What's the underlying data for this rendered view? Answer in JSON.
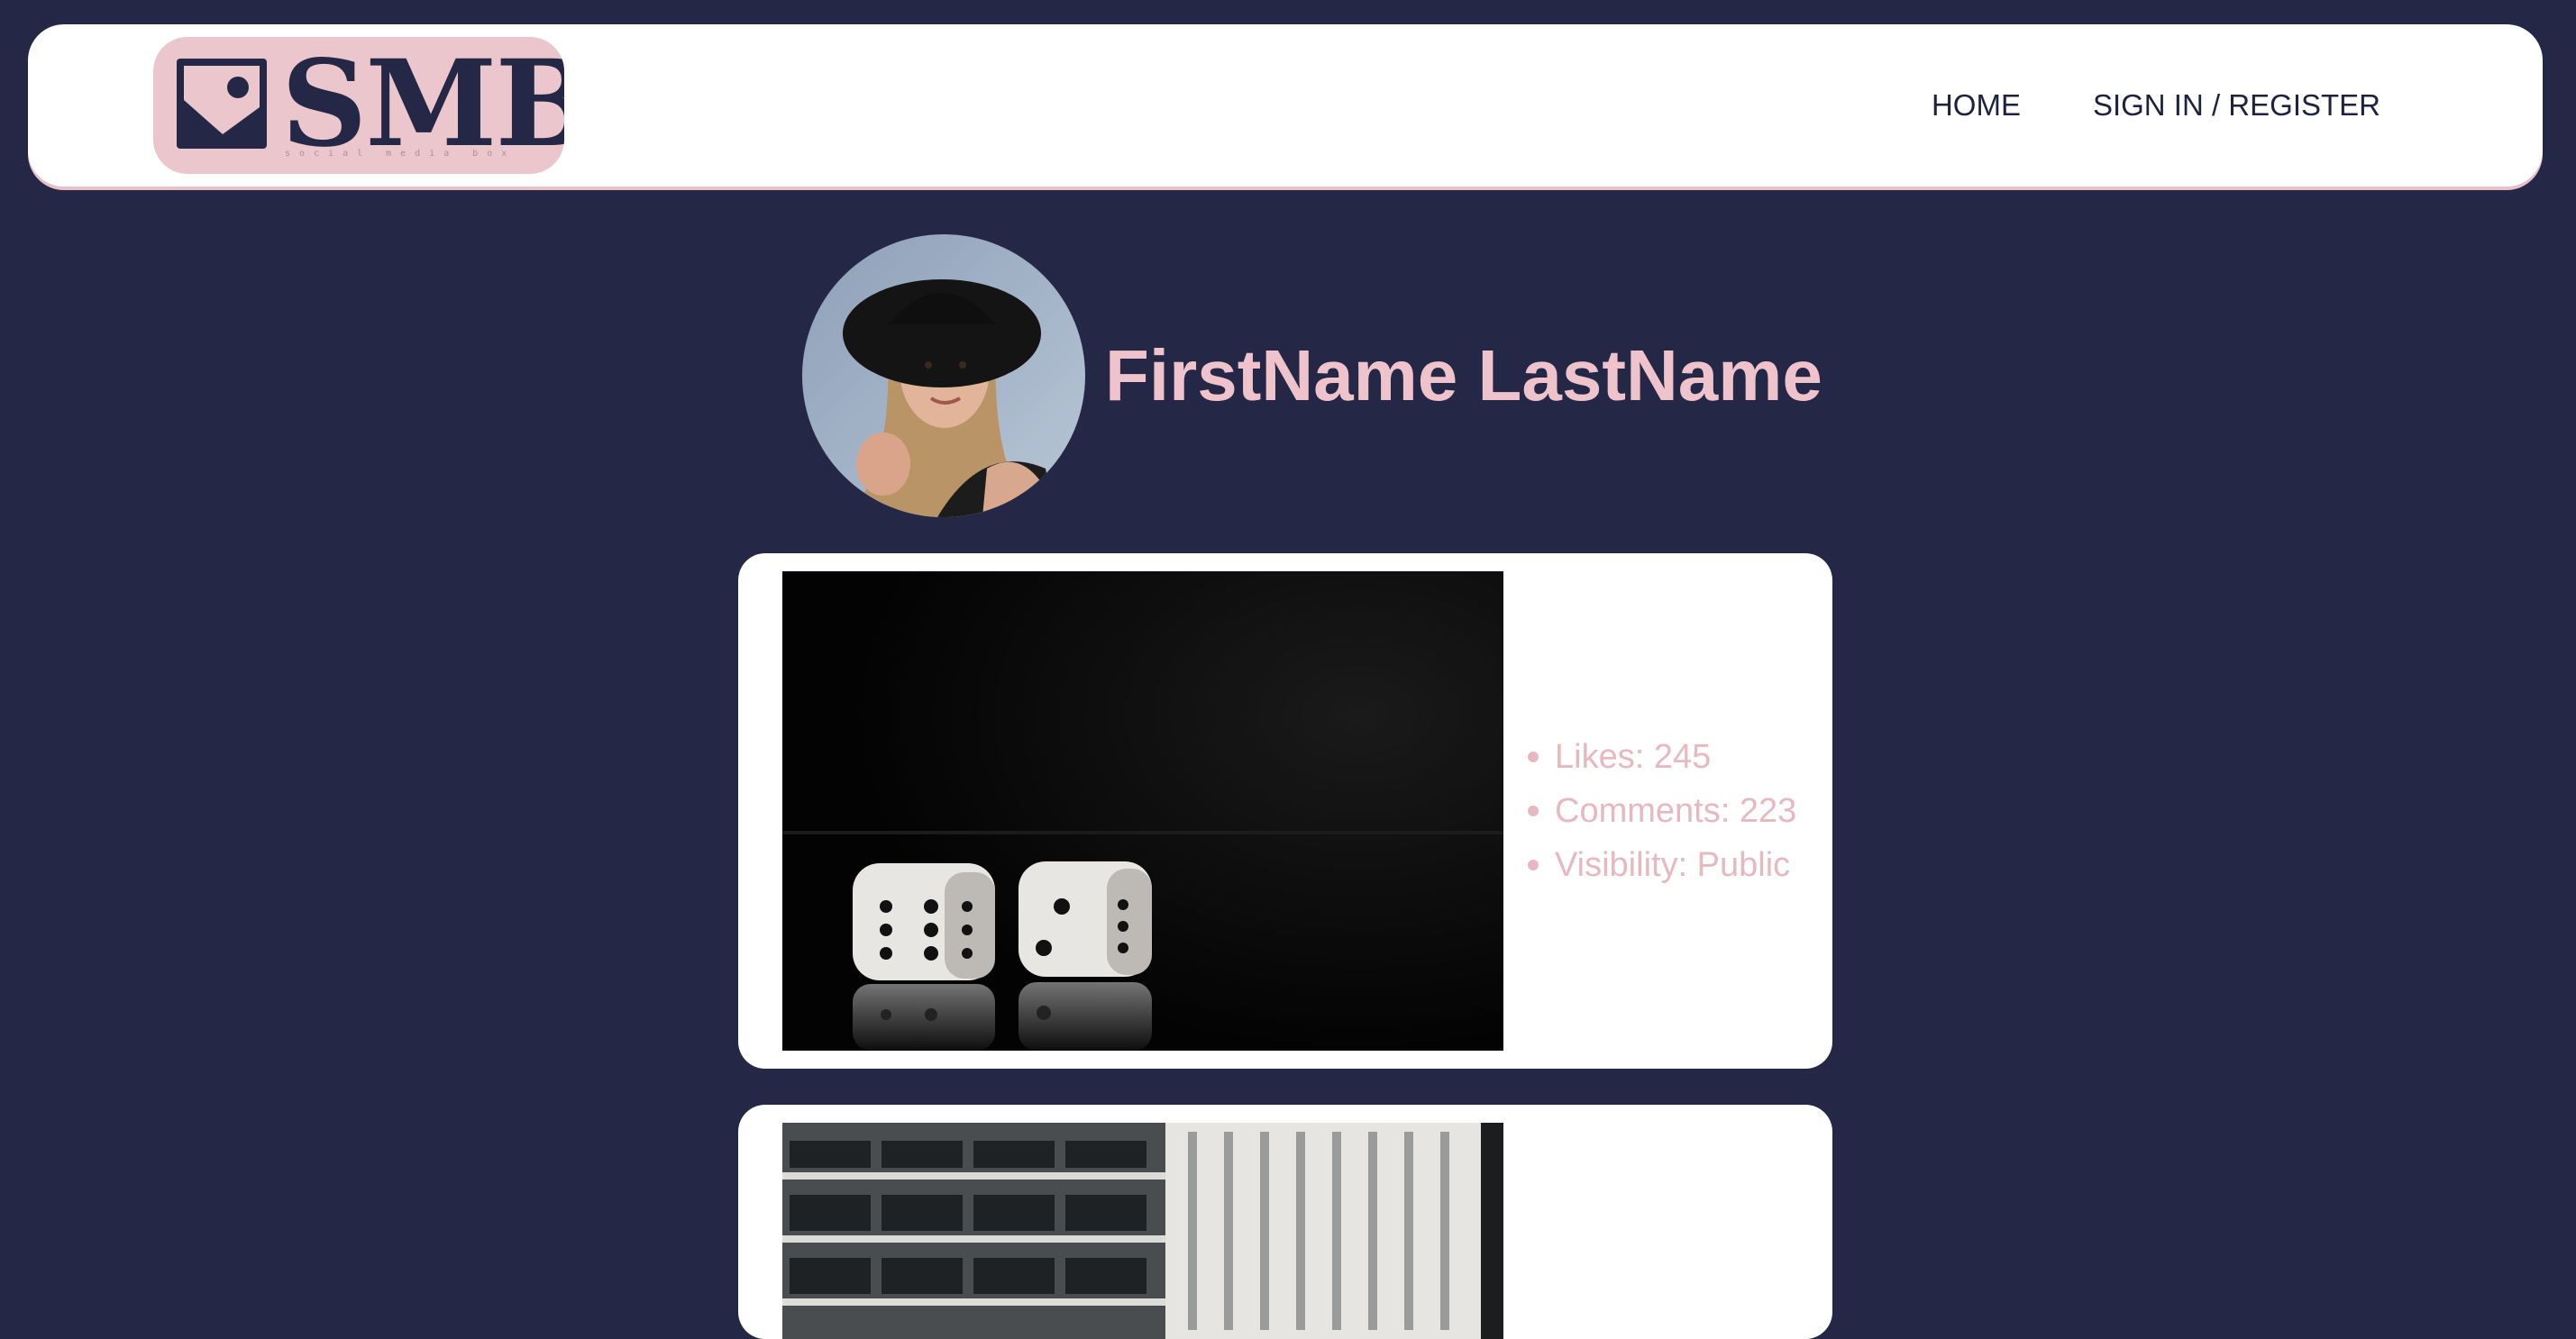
{
  "app": {
    "logo_text": "SMB",
    "logo_tagline": "social media box"
  },
  "nav": {
    "items": [
      {
        "label": "HOME"
      },
      {
        "label": "SIGN IN / REGISTER"
      }
    ]
  },
  "profile": {
    "name": "FirstName LastName"
  },
  "posts": [
    {
      "stats": [
        {
          "text": "Likes: 245"
        },
        {
          "text": "Comments: 223"
        },
        {
          "text": "Visibility: Public"
        }
      ]
    },
    {
      "stats": []
    }
  ],
  "colors": {
    "background": "#242846",
    "accent_pink": "#efc3cb",
    "logo_bg": "#ebc6cd",
    "nav_text": "#1e2140",
    "card_bg": "#ffffff"
  },
  "icons": [
    "image-icon"
  ]
}
